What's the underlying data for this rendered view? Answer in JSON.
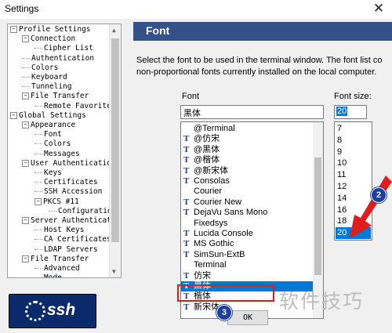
{
  "window": {
    "title": "Settings",
    "close_glyph": "✕"
  },
  "tree": {
    "rows": [
      {
        "label": "Profile Settings",
        "level": 0,
        "toggle": "−"
      },
      {
        "label": "Connection",
        "level": 1,
        "toggle": "−"
      },
      {
        "label": "Cipher List",
        "level": 2,
        "toggle": ""
      },
      {
        "label": "Authentication",
        "level": 1,
        "toggle": ""
      },
      {
        "label": "Colors",
        "level": 1,
        "toggle": ""
      },
      {
        "label": "Keyboard",
        "level": 1,
        "toggle": ""
      },
      {
        "label": "Tunneling",
        "level": 1,
        "toggle": ""
      },
      {
        "label": "File Transfer",
        "level": 1,
        "toggle": "−"
      },
      {
        "label": "Remote Favorite",
        "level": 2,
        "toggle": ""
      },
      {
        "label": "Global Settings",
        "level": 0,
        "toggle": "−"
      },
      {
        "label": "Appearance",
        "level": 1,
        "toggle": "−"
      },
      {
        "label": "Font",
        "level": 2,
        "toggle": ""
      },
      {
        "label": "Colors",
        "level": 2,
        "toggle": ""
      },
      {
        "label": "Messages",
        "level": 2,
        "toggle": ""
      },
      {
        "label": "User Authenticatio",
        "level": 1,
        "toggle": "−"
      },
      {
        "label": "Keys",
        "level": 2,
        "toggle": ""
      },
      {
        "label": "Certificates",
        "level": 2,
        "toggle": ""
      },
      {
        "label": "SSH Accession",
        "level": 2,
        "toggle": ""
      },
      {
        "label": "PKCS #11",
        "level": 2,
        "toggle": "−"
      },
      {
        "label": "Configuratio",
        "level": 3,
        "toggle": ""
      },
      {
        "label": "Server Authenticat",
        "level": 1,
        "toggle": "−"
      },
      {
        "label": "Host Keys",
        "level": 2,
        "toggle": ""
      },
      {
        "label": "CA Certificates",
        "level": 2,
        "toggle": ""
      },
      {
        "label": "LDAP Servers",
        "level": 2,
        "toggle": ""
      },
      {
        "label": "File Transfer",
        "level": 1,
        "toggle": "−"
      },
      {
        "label": "Advanced",
        "level": 2,
        "toggle": ""
      },
      {
        "label": "Mode",
        "level": 2,
        "toggle": ""
      }
    ]
  },
  "logo": {
    "text": "ssh"
  },
  "panel": {
    "header": "Font",
    "description_line1": "Select the font to be used in the terminal window. The font list co",
    "description_line2": "non-proportional fonts currently installed on the local computer.",
    "font_label": "Font",
    "size_label": "Font size:",
    "font_value": "黑体",
    "size_value": "20",
    "fonts": [
      {
        "name": "@Terminal",
        "tt": false
      },
      {
        "name": "@仿宋",
        "tt": true
      },
      {
        "name": "@黑体",
        "tt": true
      },
      {
        "name": "@楷体",
        "tt": true
      },
      {
        "name": "@新宋体",
        "tt": true
      },
      {
        "name": "Consolas",
        "tt": true
      },
      {
        "name": "Courier",
        "tt": false
      },
      {
        "name": "Courier New",
        "tt": true
      },
      {
        "name": "DejaVu Sans Mono",
        "tt": true
      },
      {
        "name": "Fixedsys",
        "tt": false
      },
      {
        "name": "Lucida Console",
        "tt": true
      },
      {
        "name": "MS Gothic",
        "tt": true
      },
      {
        "name": "SimSun-ExtB",
        "tt": true
      },
      {
        "name": "Terminal",
        "tt": false
      },
      {
        "name": "仿宋",
        "tt": true
      },
      {
        "name": "黑体",
        "tt": true,
        "selected": true
      },
      {
        "name": "楷体",
        "tt": true
      },
      {
        "name": "新宋体",
        "tt": true
      }
    ],
    "sizes": [
      "7",
      "8",
      "9",
      "10",
      "11",
      "12",
      "14",
      "16",
      "18",
      "20"
    ],
    "selected_size": "20",
    "ok_label": "OK"
  },
  "annotations": {
    "badge_size": "2",
    "badge_ok": "3",
    "arrow_color": "#e01c1c"
  },
  "watermark": "软件技巧",
  "colors": {
    "header_bg": "#34518a",
    "selection": "#0078d7",
    "highlight": "#e01c1c",
    "logo_bg": "#0a2a6b"
  }
}
